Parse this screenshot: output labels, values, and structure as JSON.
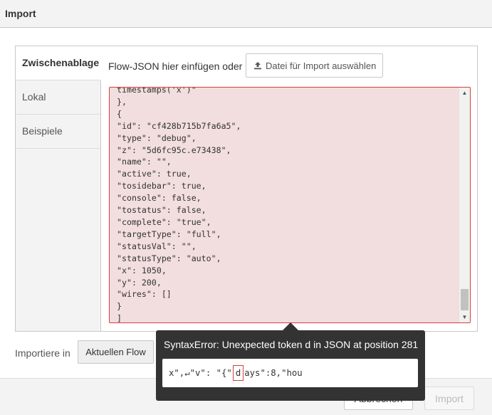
{
  "dialog": {
    "title": "Import"
  },
  "tabs": [
    {
      "label": "Zwischenablage",
      "active": true
    },
    {
      "label": "Lokal",
      "active": false
    },
    {
      "label": "Beispiele",
      "active": false
    }
  ],
  "clipboard": {
    "intro": "Flow-JSON hier einfügen oder",
    "file_button_label": "Datei für Import auswählen",
    "file_button_icon": "upload-icon"
  },
  "editor": {
    "lines": [
      "timestamps('x')\"",
      "},",
      "{",
      "\"id\": \"cf428b715b7fa6a5\",",
      "\"type\": \"debug\",",
      "\"z\": \"5d6fc95c.e73438\",",
      "\"name\": \"\",",
      "\"active\": true,",
      "\"tosidebar\": true,",
      "\"console\": false,",
      "\"tostatus\": false,",
      "\"complete\": \"true\",",
      "\"targetType\": \"full\",",
      "\"statusVal\": \"\",",
      "\"statusType\": \"auto\",",
      "\"x\": 1050,",
      "\"y\": 200,",
      "\"wires\": []",
      "}",
      "]"
    ],
    "scroll_up_icon": "triangle-up-icon",
    "scroll_down_icon": "triangle-down-icon"
  },
  "import_target": {
    "label": "Importiere in",
    "current_flow_label": "Aktuellen Flow"
  },
  "footer": {
    "cancel_label": "Abbrechen",
    "import_label": "Import"
  },
  "error_tooltip": {
    "message": "SyntaxError: Unexpected token d in JSON at position 281",
    "snippet_before": "x\",↵\"v\": \"{\"",
    "snippet_error_char": "d",
    "snippet_after": "ays\":8,\"hou"
  },
  "colors": {
    "error_border": "#d43f3a",
    "error_background": "#f2dede",
    "tooltip_background": "#333333"
  }
}
